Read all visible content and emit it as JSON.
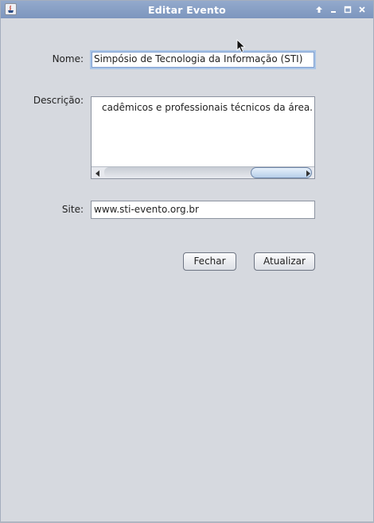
{
  "window": {
    "title": "Editar Evento",
    "icons": [
      "java-app-icon",
      "maximize-up-arrow-icon",
      "minimize-icon",
      "restore-icon",
      "close-icon"
    ]
  },
  "form": {
    "nome_label": "Nome:",
    "nome_value": "Simpósio de Tecnologia da Informação (STI)",
    "descricao_label": "Descrição:",
    "descricao_value": "cadêmicos e professionais técnicos da área.",
    "site_label": "Site:",
    "site_value": "www.sti-evento.org.br"
  },
  "buttons": {
    "fechar": "Fechar",
    "atualizar": "Atualizar"
  },
  "colors": {
    "titlebar": "#859dc4",
    "background": "#d6d9df",
    "focus_border": "#a9c4e6"
  }
}
